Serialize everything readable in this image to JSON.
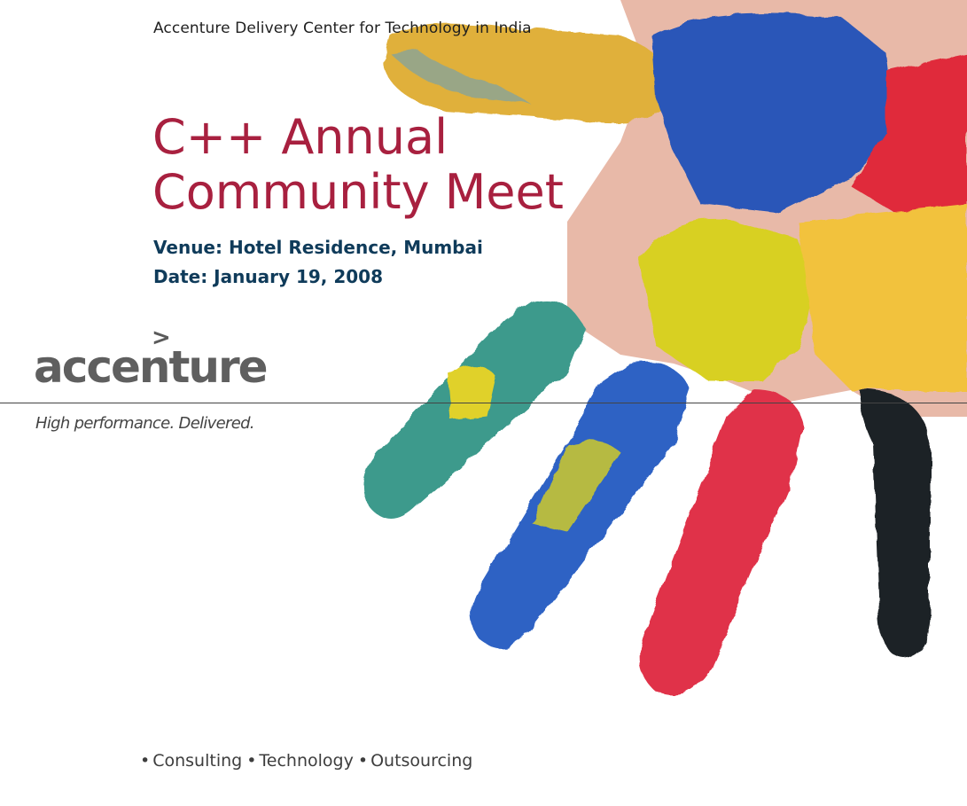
{
  "header": {
    "org_line": "Accenture Delivery Center for Technology in India"
  },
  "event": {
    "title_line1": "C++ Annual",
    "title_line2": "Community Meet",
    "venue": "Venue: Hotel Residence, Mumbai",
    "date": "Date: January 19, 2008"
  },
  "brand": {
    "logo_chevron": ">",
    "logo_text": "accenture",
    "tagline": "High performance. Delivered."
  },
  "footer": {
    "bullet": "•",
    "services": [
      "Consulting",
      "Technology",
      "Outsourcing"
    ]
  },
  "colors": {
    "title": "#a8203f",
    "details": "#0f3b5a",
    "logo": "#5f5f5f"
  },
  "artwork": {
    "subject": "painted-hand-icon"
  }
}
